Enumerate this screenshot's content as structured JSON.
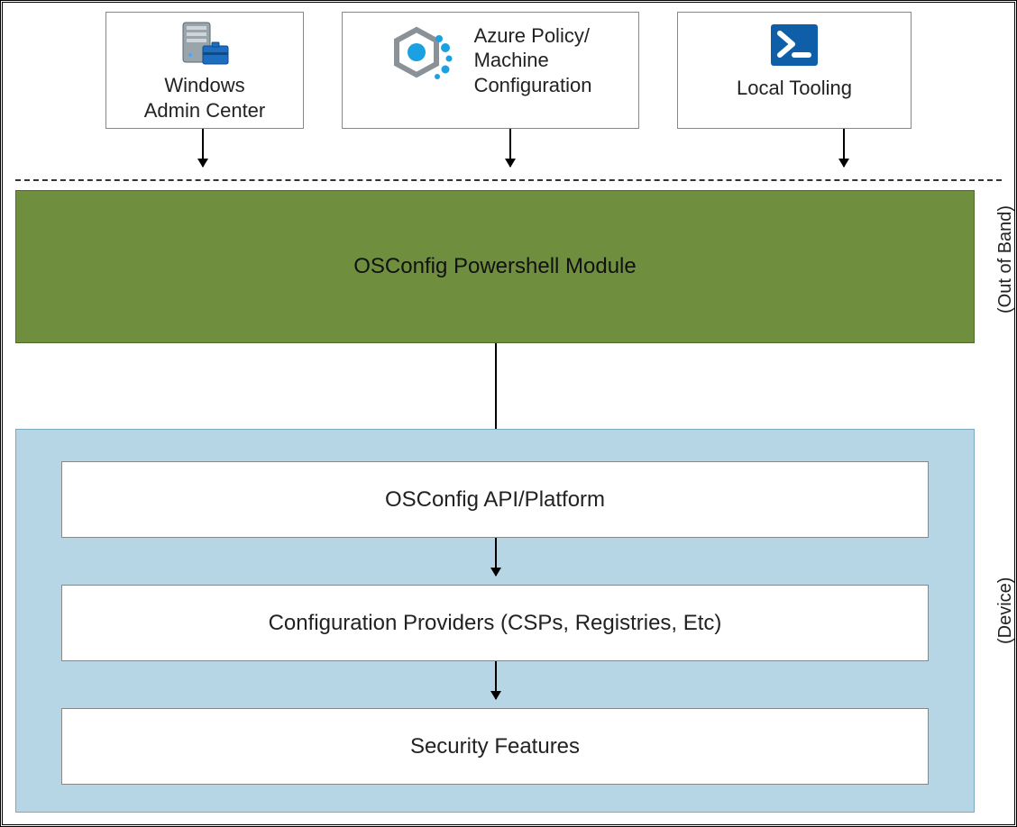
{
  "top_cards": {
    "wac": {
      "line1": "Windows",
      "line2": "Admin Center"
    },
    "azure": {
      "line1": "Azure Policy/",
      "line2": "Machine",
      "line3": "Configuration"
    },
    "local": {
      "line1": "Local Tooling"
    }
  },
  "green_box": "OSConfig Powershell Module",
  "blue_cards": {
    "api": "OSConfig API/Platform",
    "providers": "Configuration Providers (CSPs, Registries, Etc)",
    "security": "Security Features"
  },
  "side_labels": {
    "oob": "(Out of Band)",
    "device": "(Device)"
  }
}
